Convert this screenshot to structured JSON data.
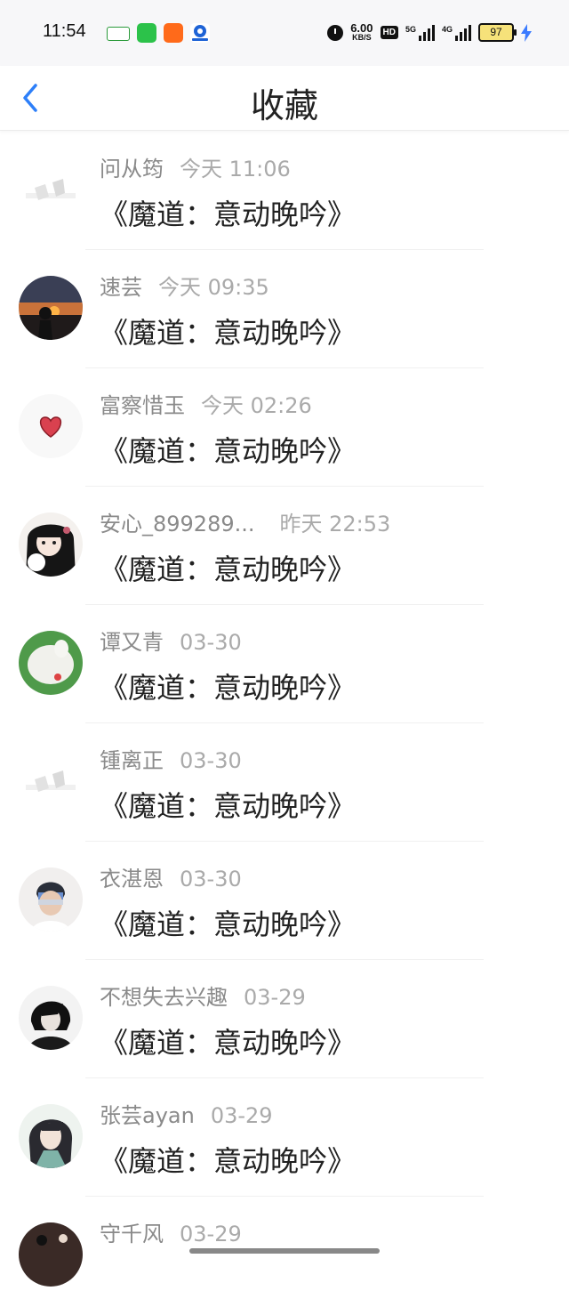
{
  "status_bar": {
    "time": "11:54",
    "speed_value": "6.00",
    "speed_unit": "KB/S",
    "hd_label": "HD",
    "signal_1_label": "5G",
    "signal_2_label": "4G",
    "battery_level": "97",
    "notification_icons": [
      "oppo-app-icon",
      "wechat-icon",
      "taobao-icon",
      "browser-icon"
    ],
    "colors": {
      "battery": "#f6e27a",
      "bolt": "#3b7bff"
    }
  },
  "header": {
    "title": "收藏",
    "back_icon": "chevron-left-icon",
    "accent_color": "#2d7ff9"
  },
  "items": [
    {
      "name": "问从筠",
      "time": "今天 11:06",
      "title": "《魔道：意动晚吟》",
      "avatar": "avatar-placeholder"
    },
    {
      "name": "速芸",
      "time": "今天 09:35",
      "title": "《魔道：意动晚吟》",
      "avatar": "avatar-sunset"
    },
    {
      "name": "富察惜玉",
      "time": "今天 02:26",
      "title": "《魔道：意动晚吟》",
      "avatar": "avatar-heart"
    },
    {
      "name": "安心_899289...",
      "time": "昨天 22:53",
      "title": "《魔道：意动晚吟》",
      "avatar": "avatar-anime-girl"
    },
    {
      "name": "谭又青",
      "time": "03-30",
      "title": "《魔道：意动晚吟》",
      "avatar": "avatar-green-toy"
    },
    {
      "name": "锺离正",
      "time": "03-30",
      "title": "《魔道：意动晚吟》",
      "avatar": "avatar-placeholder"
    },
    {
      "name": "衣湛恩",
      "time": "03-30",
      "title": "《魔道：意动晚吟》",
      "avatar": "avatar-boy"
    },
    {
      "name": "不想失去兴趣",
      "time": "03-29",
      "title": "《魔道：意动晚吟》",
      "avatar": "avatar-dark-anime"
    },
    {
      "name": "张芸ayan",
      "time": "03-29",
      "title": "《魔道：意动晚吟》",
      "avatar": "avatar-ink-anime"
    },
    {
      "name": "守千风",
      "time": "03-29",
      "title": "",
      "avatar": "avatar-dark"
    }
  ]
}
